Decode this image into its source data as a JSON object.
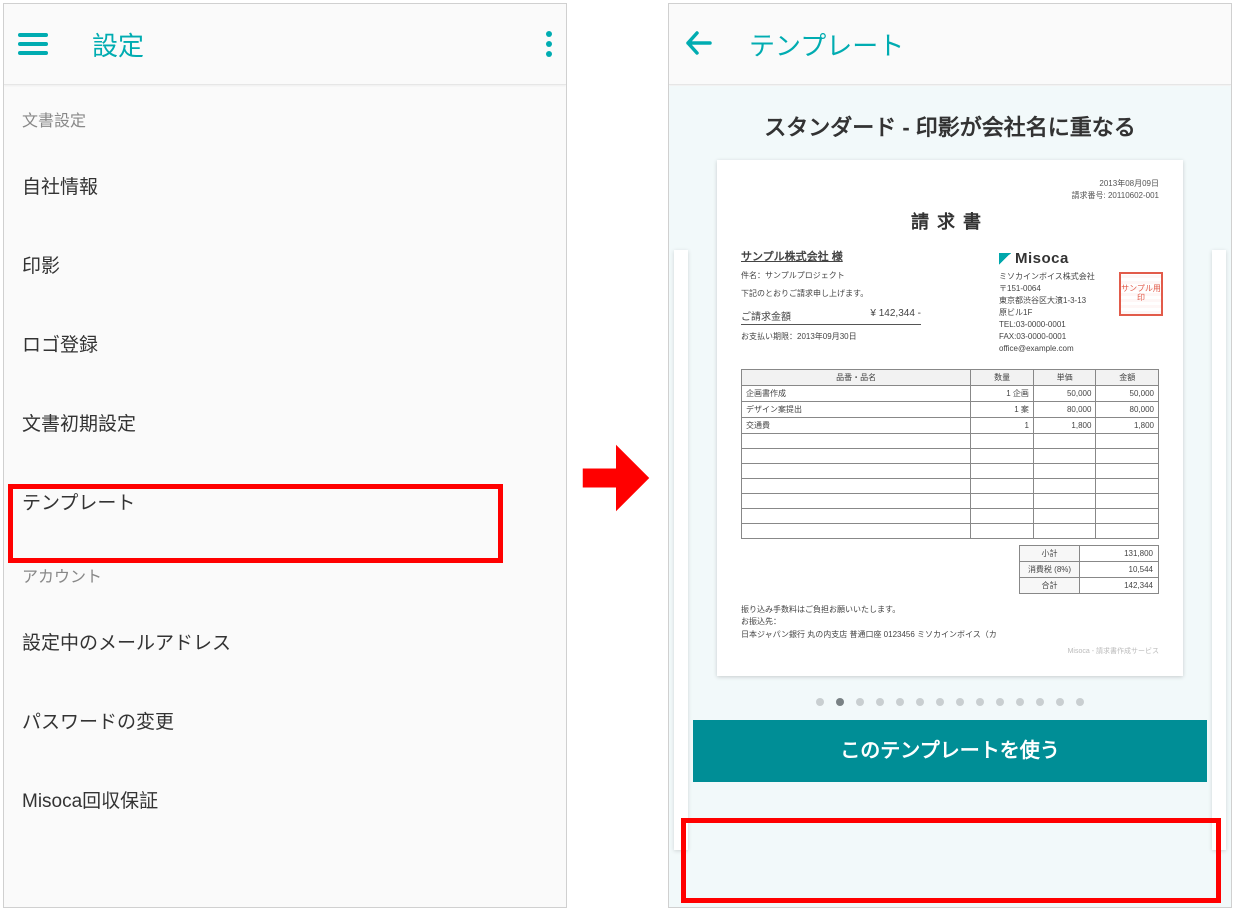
{
  "left": {
    "title": "設定",
    "sections": [
      {
        "label": "文書設定",
        "items": [
          "自社情報",
          "印影",
          "ロゴ登録",
          "文書初期設定",
          "テンプレート"
        ]
      },
      {
        "label": "アカウント",
        "items": [
          "設定中のメールアドレス",
          "パスワードの変更",
          "Misoca回収保証"
        ]
      }
    ]
  },
  "right": {
    "title": "テンプレート",
    "current_template": "スタンダード - 印影が会社名に重なる",
    "button": "このテンプレートを使う",
    "pager": {
      "count": 14,
      "active": 1
    },
    "invoice": {
      "date": "2013年08月09日",
      "number_label": "請求番号",
      "number": "20110602-001",
      "heading": "請求書",
      "client": "サンプル株式会社 様",
      "subject_label": "件名",
      "subject": "サンプルプロジェクト",
      "intro": "下記のとおりご請求申し上げます。",
      "amount_label": "ご請求金額",
      "amount": "¥ 142,344 -",
      "due_label": "お支払い期限",
      "due": "2013年09月30日",
      "sender": {
        "logo_text": "Misoca",
        "name": "ミソカインボイス株式会社",
        "postal": "〒151-0064",
        "address": "東京都渋谷区大濱1-3-13",
        "building": "原ビル1F",
        "tel": "TEL:03-0000-0001",
        "fax": "FAX:03-0000-0001",
        "email": "office@example.com",
        "stamp": "サンプル用印"
      },
      "columns": [
        "品番・品名",
        "数量",
        "単価",
        "金額"
      ],
      "items": [
        {
          "name": "企画書作成",
          "qty": "1 企画",
          "unit": "50,000",
          "amount": "50,000"
        },
        {
          "name": "デザイン案提出",
          "qty": "1 案",
          "unit": "80,000",
          "amount": "80,000"
        },
        {
          "name": "交通費",
          "qty": "1",
          "unit": "1,800",
          "amount": "1,800"
        }
      ],
      "blank_rows": 7,
      "totals": [
        {
          "label": "小計",
          "value": "131,800"
        },
        {
          "label": "消費税 (8%)",
          "value": "10,544"
        },
        {
          "label": "合計",
          "value": "142,344"
        }
      ],
      "footer_note": "振り込み手数料はご負担お願いいたします。",
      "bank_label": "お振込先：",
      "bank": "日本ジャパン銀行 丸の内支店 普通口座 0123456 ミソカインボイス（カ",
      "brand_foot": "Misoca - 請求書作成サービス"
    }
  }
}
